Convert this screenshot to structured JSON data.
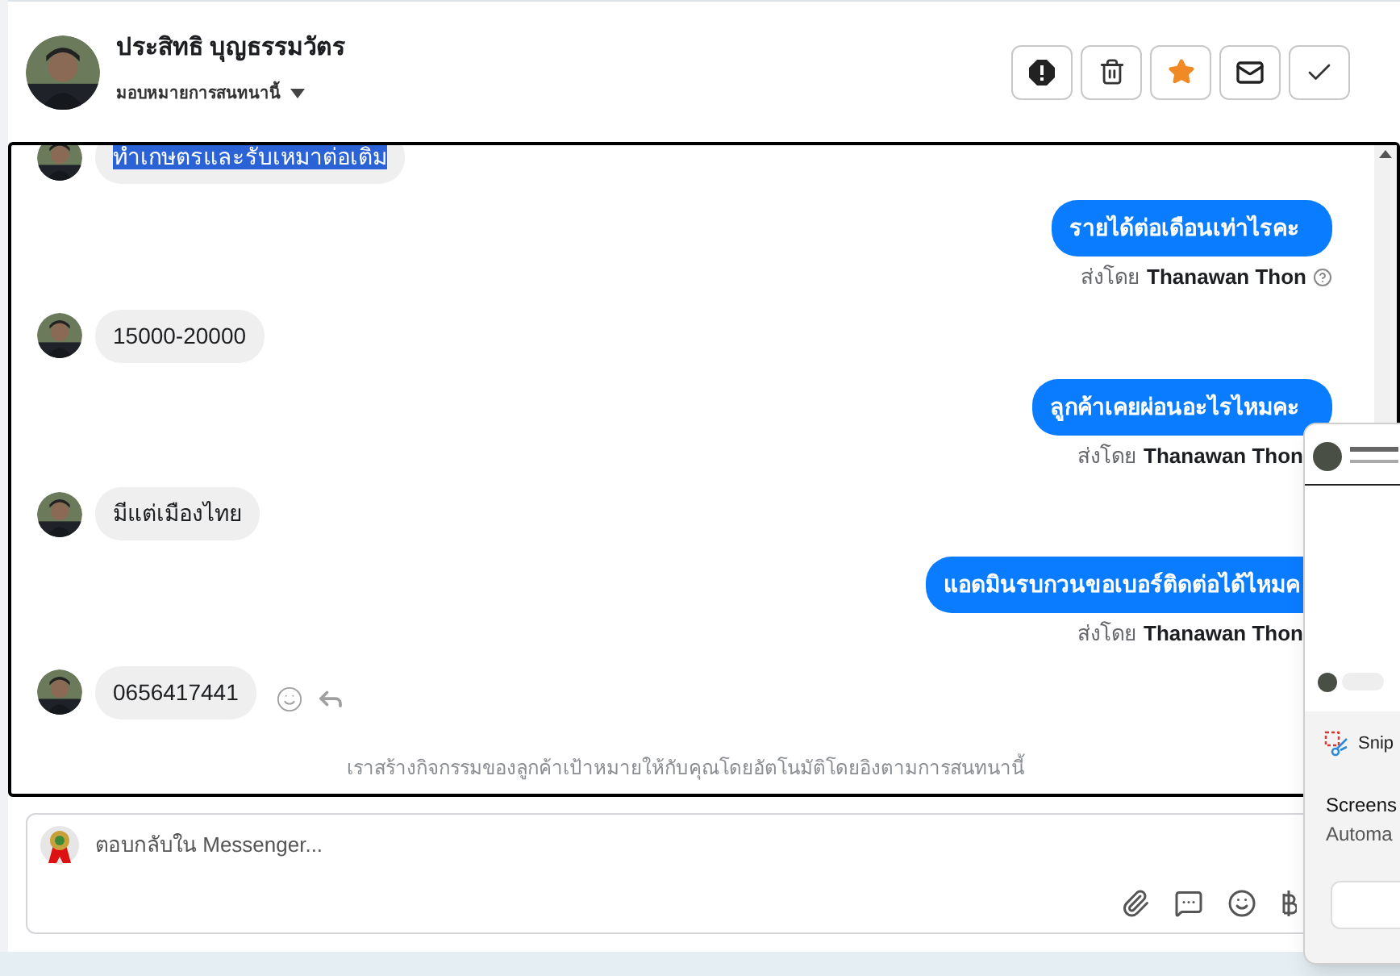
{
  "header": {
    "name": "ประสิทธิ บุญธรรมวัตร",
    "assign_label": "มอบหมายการสนทนานี้"
  },
  "messages": [
    {
      "kind": "incoming",
      "text": "ทำเกษตรและรับเหมาต่อเติม",
      "highlighted": true
    },
    {
      "kind": "outgoing",
      "text": "รายได้ต่อเดือนเท่าไรคะ",
      "sent_by": "ส่งโดย",
      "sender": "Thanawan Thon",
      "help": true
    },
    {
      "kind": "incoming",
      "text": "15000-20000",
      "highlighted": false
    },
    {
      "kind": "outgoing",
      "text": "ลูกค้าเคยผ่อนอะไรไหมคะ",
      "sent_by": "ส่งโดย",
      "sender": "Thanawan Thon",
      "help": false
    },
    {
      "kind": "incoming",
      "text": "มีแต่เมืองไทย",
      "highlighted": false
    },
    {
      "kind": "outgoing",
      "text": "แอดมินรบกวนขอเบอร์ติดต่อได้ไหมค",
      "sent_by": "ส่งโดย",
      "sender": "Thanawan Thon",
      "help": false
    },
    {
      "kind": "incoming",
      "text": "0656417441",
      "highlighted": false,
      "reactions": true
    }
  ],
  "activity_note": "เราสร้างกิจกรรมของลูกค้าเป้าหมายให้กับคุณโดยอัตโนมัติโดยอิงตามการสนทนานี้",
  "composer": {
    "placeholder": "ตอบกลับใน Messenger..."
  },
  "notification": {
    "app": "Snip",
    "title": "Screens",
    "body": "Automa"
  }
}
